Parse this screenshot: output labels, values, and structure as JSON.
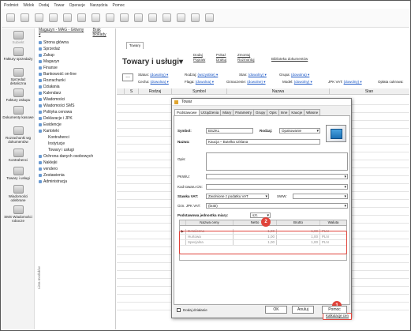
{
  "menu": [
    "Podmiot",
    "Widok",
    "Dodaj",
    "Towar",
    "Operacje",
    "Narzędzia",
    "Pomoc"
  ],
  "left_bar": {
    "top_label": "Subiekt",
    "items": [
      "Faktury sprzedaży",
      "Sprzedaż detaliczna",
      "Faktury zakupu",
      "Dokumenty kasowe",
      "Rozrachunki wg dokumentów",
      "Kontrahenci",
      "Towary i usługi",
      "Wiadomości odebrane",
      "SMS Wiadomości robocze"
    ]
  },
  "tree": {
    "header_left": "Magazyn - MAG - Główny ▾",
    "header_right": "Brak blokady",
    "items": [
      "Strona główna",
      "Sprzedaż",
      "Zakup",
      "Magazyn",
      "Finanse",
      "Bankowość on-line",
      "Rozrachunki",
      "Działania",
      "Kalendarz",
      "Wiadomości",
      "Wiadomości SMS",
      "Polityka cenowa",
      "Deklaracje i JPK",
      "Ewidencje",
      "Kartoteki",
      "Kontrahenci",
      "Instytucje",
      "Towary i usługi",
      "Ochrona danych osobowych",
      "Naklejki",
      "vendero",
      "Zestawienia",
      "Administracja"
    ],
    "side_label": "Lista modułów"
  },
  "main": {
    "tab": "Towary",
    "title": "Towary i usługi▾",
    "links": [
      [
        "Dodaj",
        "Popraw"
      ],
      [
        "Pokaż",
        "Drukuj"
      ],
      [
        "Zmontuj",
        "Rozmontuj"
      ],
      [
        "Biblioteka dokumentów"
      ]
    ],
    "filters_row1": [
      [
        "Status:",
        "(dowolny) ▾"
      ],
      [
        "Rodzaj:",
        "(wszystkie) ▾"
      ],
      [
        "Stan:",
        "(dowolny) ▾"
      ],
      [
        "Grupa:",
        "(dowolna) ▾"
      ]
    ],
    "filters_row2": [
      [
        "Cecha:",
        "(dowolna) ▾"
      ],
      [
        "Flaga:",
        "(dowolna) ▾"
      ],
      [
        "Oznaczenie:",
        "(dowolne) ▾"
      ],
      [
        "Model:",
        "(dowolny) ▾"
      ],
      [
        "JPK VAT:",
        "(dowolny) ▾"
      ],
      [
        "Opłata cukrowa:",
        ""
      ]
    ],
    "dots": "...",
    "columns": [
      "S",
      "Rodzaj",
      "Symbol",
      "Nazwa",
      "Stan"
    ]
  },
  "dialog": {
    "title": "Towar",
    "tabs": [
      "Podstawowe",
      "Urządzenia",
      "Miary",
      "Parametry",
      "Grupy",
      "Opis",
      "Inne",
      "Kaucje",
      "Własne"
    ],
    "symbol_label": "Symbol:",
    "symbol_value": "BSZKL",
    "rodzaj_label": "Rodzaj:",
    "rodzaj_value": "Opakowanie",
    "nazwa_label": "Nazwa:",
    "nazwa_value": "Kaucja – Butelka szklana",
    "opis_label": "Opis:",
    "pkwiu_label": "PKWiU:",
    "cn_label": "Kod towaru CN:",
    "vat_label": "Stawka VAT:",
    "vat_value": "Zwolnione z podatku VAT",
    "sww_label": "SWW:",
    "jpk_label": "Ozn. JPK VAT:",
    "jpk_value": "(brak)",
    "jm_label": "Podstawowa jednostka miary:",
    "jm_value": "szt.",
    "price_columns": [
      "Nazwa ceny",
      "Netto",
      "Brutto",
      "Waluta"
    ],
    "price_rows": [
      [
        "Detaliczna",
        "1,00",
        "1,00",
        "PLN"
      ],
      [
        "Hurtowa",
        "1,00",
        "1,00",
        "PLN"
      ],
      [
        "Specjalna",
        "1,00",
        "1,00",
        "PLN"
      ]
    ],
    "kalkulacje_button": "Kalkulacje cen",
    "add_action_label": "Dodaj działanie",
    "ok_button": "OK",
    "cancel_button": "Anuluj",
    "help_button": "Pomoc"
  },
  "annotations": {
    "badge1": "1",
    "badge2": "2",
    "color": "#e0433a"
  }
}
